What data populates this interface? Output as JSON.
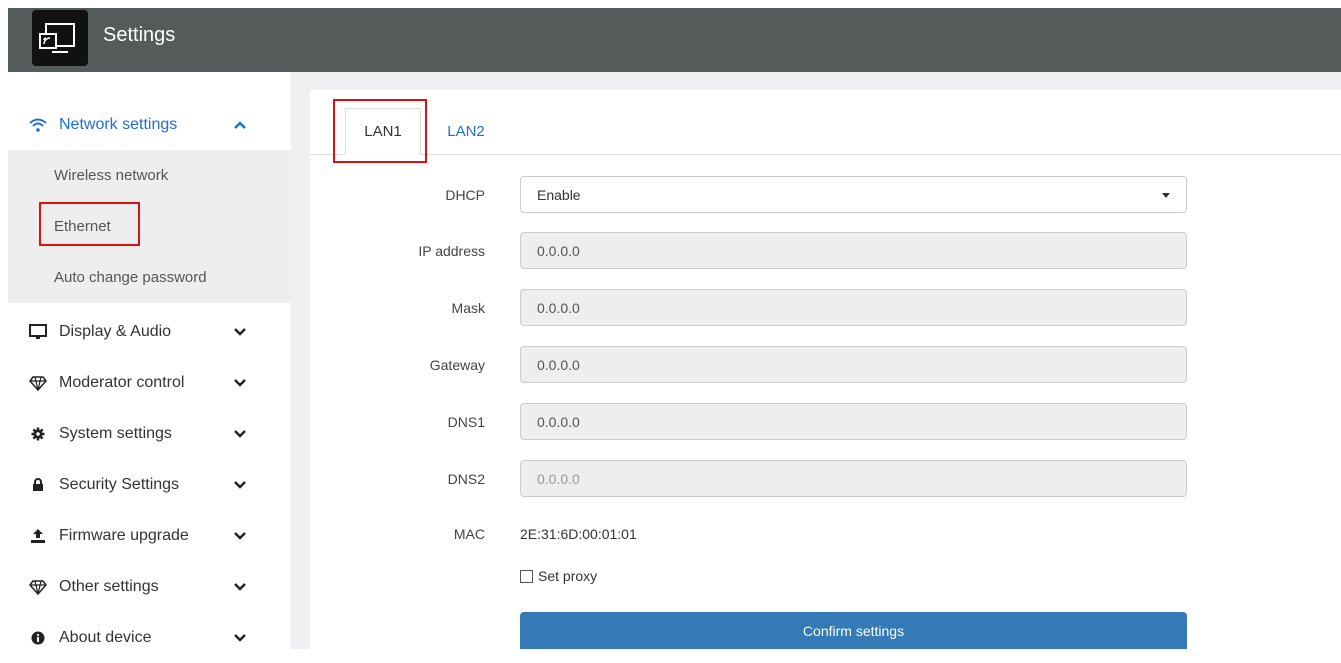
{
  "header": {
    "title": "Settings",
    "app_icon": "cast-screen-icon"
  },
  "sidebar": {
    "items": [
      {
        "label": "Network settings",
        "icon": "wifi-icon",
        "expanded": true
      },
      {
        "label": "Display & Audio",
        "icon": "monitor-icon"
      },
      {
        "label": "Moderator control",
        "icon": "diamond-icon"
      },
      {
        "label": "System settings",
        "icon": "gear-icon"
      },
      {
        "label": "Security Settings",
        "icon": "lock-icon"
      },
      {
        "label": "Firmware upgrade",
        "icon": "upload-icon"
      },
      {
        "label": "Other settings",
        "icon": "diamond-icon"
      },
      {
        "label": "About device",
        "icon": "info-icon"
      }
    ],
    "network_submenu": [
      "Wireless network",
      "Ethernet",
      "Auto change password"
    ]
  },
  "tabs": [
    {
      "label": "LAN1",
      "active": true
    },
    {
      "label": "LAN2",
      "active": false
    }
  ],
  "form": {
    "dhcp": {
      "label": "DHCP",
      "value": "Enable"
    },
    "ip": {
      "label": "IP address",
      "value": "0.0.0.0"
    },
    "mask": {
      "label": "Mask",
      "value": "0.0.0.0"
    },
    "gateway": {
      "label": "Gateway",
      "value": "0.0.0.0"
    },
    "dns1": {
      "label": "DNS1",
      "value": "0.0.0.0"
    },
    "dns2": {
      "label": "DNS2",
      "value": "0.0.0.0"
    },
    "mac": {
      "label": "MAC",
      "value": "2E:31:6D:00:01:01"
    },
    "proxy_label": "Set proxy",
    "proxy_checked": false,
    "confirm_label": "Confirm settings"
  },
  "colors": {
    "accent": "#1f6fd1",
    "header": "#555a5a",
    "button": "#337ab7",
    "highlight": "#e01010"
  }
}
